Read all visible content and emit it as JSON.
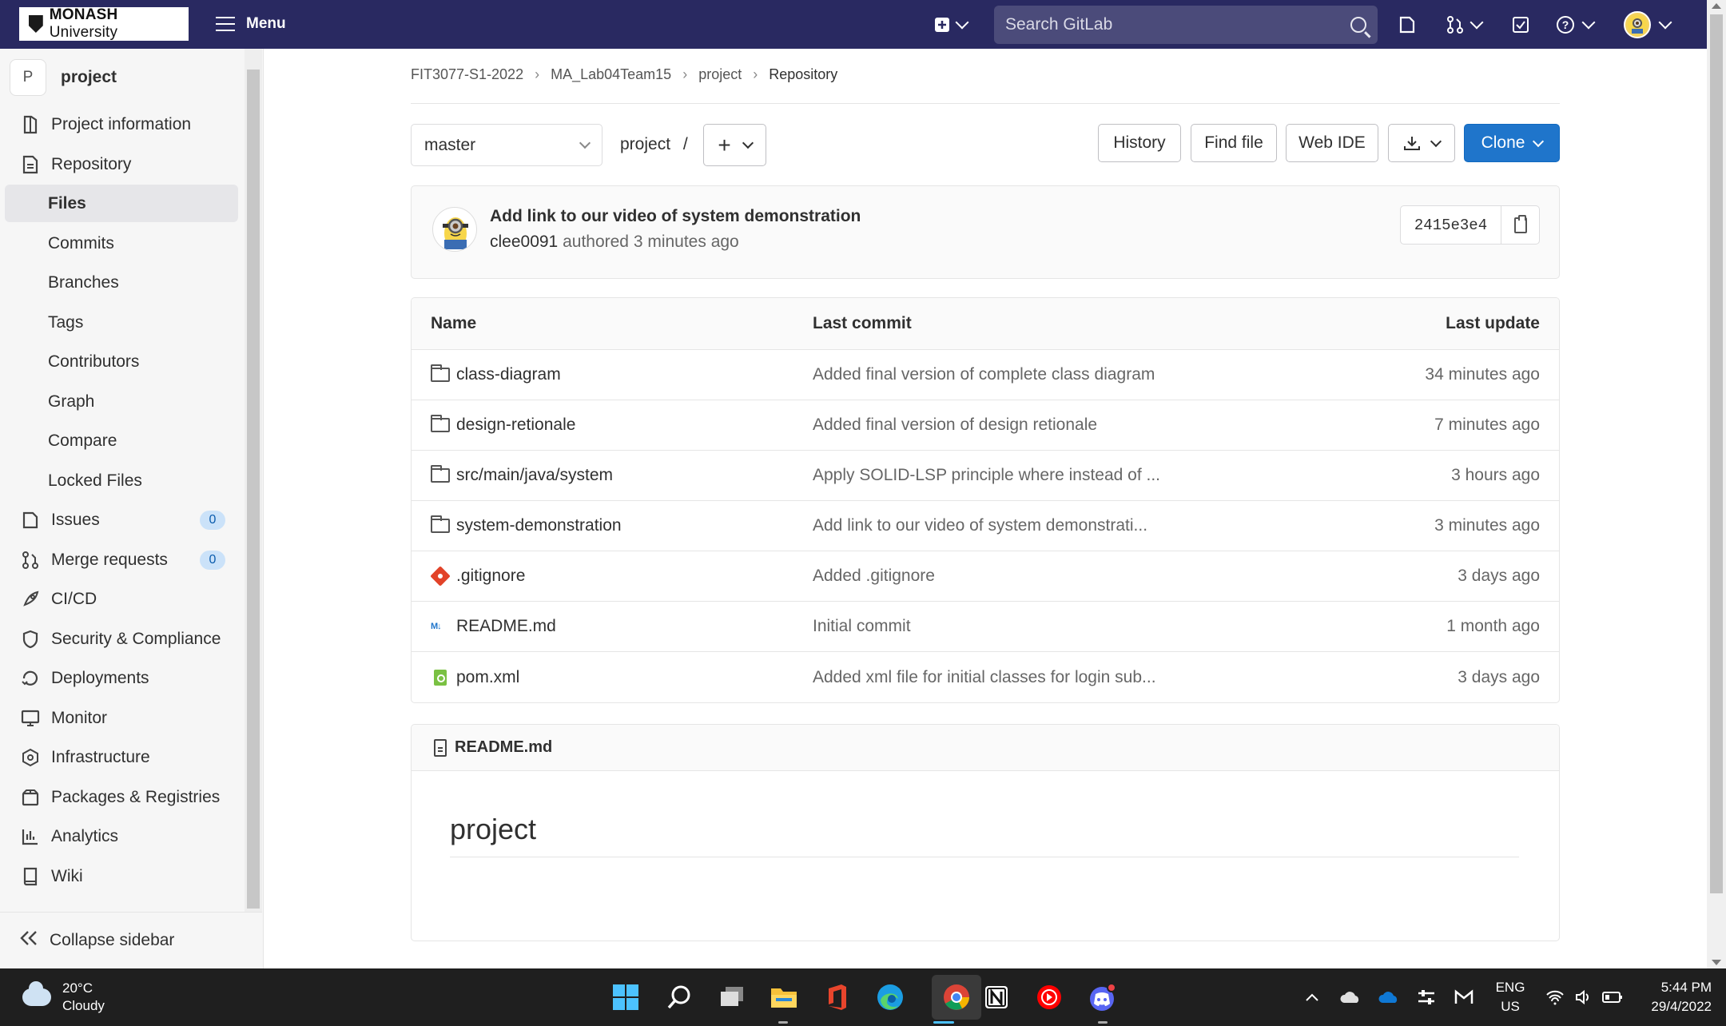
{
  "brand": {
    "name_bold": "MONASH",
    "name_rest": " University"
  },
  "topbar": {
    "menu_label": "Menu",
    "search_placeholder": "Search GitLab"
  },
  "sidebar": {
    "project_initial": "P",
    "project_name": "project",
    "items": [
      {
        "label": "Project information",
        "icon": "info-icon"
      },
      {
        "label": "Repository",
        "icon": "repository-icon"
      },
      {
        "label": "Files",
        "sub": true,
        "active": true
      },
      {
        "label": "Commits",
        "sub": true
      },
      {
        "label": "Branches",
        "sub": true
      },
      {
        "label": "Tags",
        "sub": true
      },
      {
        "label": "Contributors",
        "sub": true
      },
      {
        "label": "Graph",
        "sub": true
      },
      {
        "label": "Compare",
        "sub": true
      },
      {
        "label": "Locked Files",
        "sub": true
      },
      {
        "label": "Issues",
        "icon": "issues-icon",
        "count": "0"
      },
      {
        "label": "Merge requests",
        "icon": "merge-request-icon",
        "count": "0"
      },
      {
        "label": "CI/CD",
        "icon": "rocket-icon"
      },
      {
        "label": "Security & Compliance",
        "icon": "shield-icon"
      },
      {
        "label": "Deployments",
        "icon": "deployments-icon"
      },
      {
        "label": "Monitor",
        "icon": "monitor-icon"
      },
      {
        "label": "Infrastructure",
        "icon": "infrastructure-icon"
      },
      {
        "label": "Packages & Registries",
        "icon": "package-icon"
      },
      {
        "label": "Analytics",
        "icon": "chart-icon"
      },
      {
        "label": "Wiki",
        "icon": "book-icon"
      }
    ],
    "collapse_label": "Collapse sidebar"
  },
  "breadcrumb": [
    "FIT3077-S1-2022",
    "MA_Lab04Team15",
    "project",
    "Repository"
  ],
  "toolbar": {
    "branch": "master",
    "path": "project",
    "path_sep": "/",
    "history": "History",
    "find_file": "Find file",
    "web_ide": "Web IDE",
    "clone": "Clone"
  },
  "last_commit": {
    "title": "Add link to our video of system demonstration",
    "author": "clee0091",
    "meta": " authored 3 minutes ago",
    "sha": "2415e3e4"
  },
  "file_table": {
    "headers": {
      "name": "Name",
      "last_commit": "Last commit",
      "last_update": "Last update"
    },
    "rows": [
      {
        "type": "folder",
        "name": "class-diagram",
        "commit": "Added final version of complete class diagram",
        "updated": "34 minutes ago"
      },
      {
        "type": "folder",
        "name": "design-retionale",
        "commit": "Added final version of design retionale",
        "updated": "7 minutes ago"
      },
      {
        "type": "folder",
        "name": "src/main/java/system",
        "commit": "Apply SOLID-LSP principle where instead of ...",
        "updated": "3 hours ago"
      },
      {
        "type": "folder",
        "name": "system-demonstration",
        "commit": "Add link to our video of system demonstrati...",
        "updated": "3 minutes ago"
      },
      {
        "type": "git",
        "name": ".gitignore",
        "commit": "Added .gitignore",
        "updated": "3 days ago"
      },
      {
        "type": "md",
        "name": "README.md",
        "commit": "Initial commit",
        "updated": "1 month ago"
      },
      {
        "type": "xml",
        "name": "pom.xml",
        "commit": "Added xml file for initial classes for login sub...",
        "updated": "3 days ago"
      }
    ]
  },
  "readme": {
    "filename": "README.md",
    "heading": "project"
  },
  "taskbar": {
    "weather_temp": "20°C",
    "weather_desc": "Cloudy",
    "lang_1": "ENG",
    "lang_2": "US",
    "time": "5:44 PM",
    "date": "29/4/2022"
  },
  "colors": {
    "navbar": "#292961",
    "primary": "#1f75cb",
    "taskbar": "#1f1f1f"
  }
}
